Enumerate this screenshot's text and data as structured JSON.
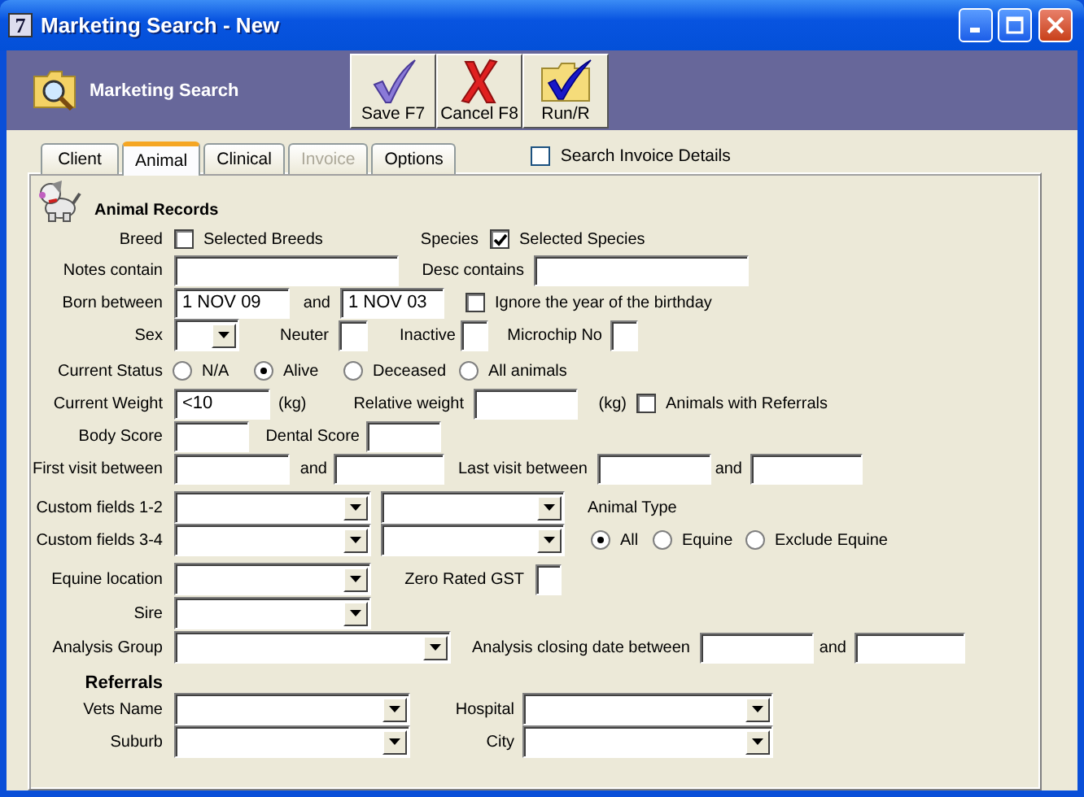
{
  "window": {
    "app_icon": "7",
    "title": "Marketing Search - New"
  },
  "toolbar": {
    "title": "Marketing Search",
    "buttons": [
      {
        "kind": "save",
        "label": "Save F7"
      },
      {
        "kind": "cancel",
        "label": "Cancel F8"
      },
      {
        "kind": "run",
        "label": "Run/R"
      }
    ]
  },
  "tabs": [
    {
      "label": "Client",
      "selected": false,
      "disabled": false
    },
    {
      "label": "Animal",
      "selected": true,
      "disabled": false
    },
    {
      "label": "Clinical",
      "selected": false,
      "disabled": false
    },
    {
      "label": "Invoice",
      "selected": false,
      "disabled": true
    },
    {
      "label": "Options",
      "selected": false,
      "disabled": false
    }
  ],
  "search_invoice_details": {
    "label": "Search Invoice Details",
    "checked": false
  },
  "animal_records": {
    "title": "Animal Records",
    "rows": [
      {
        "items": [
          {
            "kind": "label",
            "text": "Breed"
          },
          {
            "kind": "check",
            "text": "Selected Breeds",
            "checked": false
          },
          {
            "kind": "label",
            "text": "Species"
          },
          {
            "kind": "check",
            "text": "Selected Species",
            "checked": true
          }
        ]
      },
      {
        "items": [
          {
            "kind": "label",
            "text": "Notes contain"
          },
          {
            "kind": "field"
          },
          {
            "kind": "label",
            "text": "Desc contains"
          },
          {
            "kind": "field"
          }
        ]
      },
      {
        "items": [
          {
            "kind": "label",
            "text": "Born between"
          },
          {
            "kind": "field",
            "value": "1 NOV 09"
          },
          {
            "kind": "label",
            "text": "and"
          },
          {
            "kind": "field",
            "value": "1 NOV 03"
          },
          {
            "kind": "check",
            "text": "Ignore the year of the birthday",
            "checked": false
          }
        ]
      },
      {
        "items": [
          {
            "kind": "label",
            "text": "Sex"
          },
          {
            "kind": "combo"
          },
          {
            "kind": "label",
            "text": "Neuter"
          },
          {
            "kind": "box"
          },
          {
            "kind": "label",
            "text": "Inactive"
          },
          {
            "kind": "box"
          },
          {
            "kind": "label",
            "text": "Microchip No"
          },
          {
            "kind": "box"
          }
        ]
      },
      {
        "items": [
          {
            "kind": "label",
            "text": "Current Status"
          },
          {
            "kind": "radio",
            "text": "N/A",
            "selected": false
          },
          {
            "kind": "radio",
            "text": "Alive",
            "selected": true
          },
          {
            "kind": "radio",
            "text": "Deceased",
            "selected": false
          },
          {
            "kind": "radio",
            "text": "All animals",
            "selected": false
          }
        ]
      },
      {
        "items": [
          {
            "kind": "label",
            "text": "Current Weight"
          },
          {
            "kind": "field",
            "value": "<10"
          },
          {
            "kind": "label",
            "text": "(kg)"
          },
          {
            "kind": "label",
            "text": "Relative weight"
          },
          {
            "kind": "field"
          },
          {
            "kind": "label",
            "text": "(kg)"
          },
          {
            "kind": "check",
            "text": "Animals with Referrals",
            "checked": false
          }
        ]
      },
      {
        "items": [
          {
            "kind": "label",
            "text": "Body Score"
          },
          {
            "kind": "field"
          },
          {
            "kind": "label",
            "text": "Dental Score"
          },
          {
            "kind": "field"
          }
        ]
      },
      {
        "items": [
          {
            "kind": "label",
            "text": "First visit between"
          },
          {
            "kind": "field"
          },
          {
            "kind": "label",
            "text": "and"
          },
          {
            "kind": "field"
          },
          {
            "kind": "label",
            "text": "Last visit between"
          },
          {
            "kind": "field"
          },
          {
            "kind": "label",
            "text": "and"
          },
          {
            "kind": "field"
          }
        ]
      },
      {
        "items": [
          {
            "kind": "label",
            "text": "Custom fields 1-2"
          },
          {
            "kind": "combo"
          },
          {
            "kind": "combo"
          },
          {
            "kind": "label",
            "text": "Animal Type"
          }
        ]
      },
      {
        "items": [
          {
            "kind": "label",
            "text": "Custom fields 3-4"
          },
          {
            "kind": "combo"
          },
          {
            "kind": "combo"
          },
          {
            "kind": "radio",
            "text": "All",
            "selected": true
          },
          {
            "kind": "radio",
            "text": "Equine",
            "selected": false
          },
          {
            "kind": "radio",
            "text": "Exclude Equine",
            "selected": false
          }
        ]
      },
      {
        "items": [
          {
            "kind": "label",
            "text": "Equine location"
          },
          {
            "kind": "combo"
          },
          {
            "kind": "label",
            "text": "Zero Rated GST"
          },
          {
            "kind": "box"
          }
        ]
      },
      {
        "items": [
          {
            "kind": "label",
            "text": "Sire"
          },
          {
            "kind": "combo"
          }
        ]
      },
      {
        "items": [
          {
            "kind": "label",
            "text": "Analysis Group"
          },
          {
            "kind": "combo"
          },
          {
            "kind": "label",
            "text": "Analysis closing date between"
          },
          {
            "kind": "field"
          },
          {
            "kind": "label",
            "text": "and"
          },
          {
            "kind": "field"
          }
        ]
      },
      {
        "items": [
          {
            "kind": "heading",
            "text": "Referrals"
          }
        ]
      },
      {
        "items": [
          {
            "kind": "label",
            "text": "Vets Name"
          },
          {
            "kind": "combo"
          },
          {
            "kind": "label",
            "text": "Hospital"
          },
          {
            "kind": "combo"
          }
        ]
      },
      {
        "items": [
          {
            "kind": "label",
            "text": "Suburb"
          },
          {
            "kind": "combo"
          },
          {
            "kind": "label",
            "text": "City"
          },
          {
            "kind": "combo"
          }
        ]
      }
    ]
  }
}
